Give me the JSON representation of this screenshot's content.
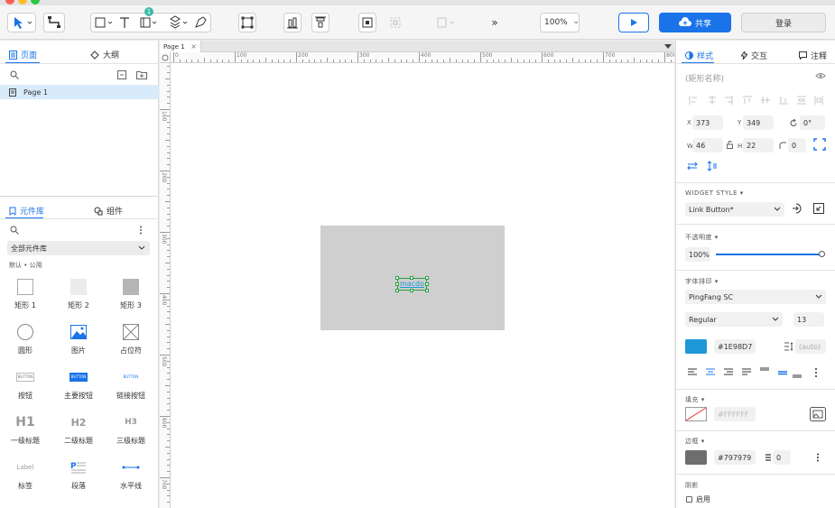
{
  "toolbar": {
    "zoom": "100%",
    "share_label": "共享",
    "login_label": "登录",
    "notification_count": "1",
    "more_symbol": "»"
  },
  "left_panel": {
    "pages_tab": "页面",
    "outline_tab": "大纲",
    "page_item": "Page 1",
    "library_tab": "元件库",
    "components_tab": "组件",
    "library_select": "全部元件库",
    "library_subtitle": "默认 • 公用",
    "widgets": [
      {
        "label": "矩形 1"
      },
      {
        "label": "矩形 2"
      },
      {
        "label": "矩形 3"
      },
      {
        "label": "圆形"
      },
      {
        "label": "图片"
      },
      {
        "label": "占位符"
      },
      {
        "label": "按钮"
      },
      {
        "label": "主要按钮"
      },
      {
        "label": "链接按钮"
      },
      {
        "label": "一级标题"
      },
      {
        "label": "二级标题"
      },
      {
        "label": "三级标题"
      },
      {
        "label": "标签"
      },
      {
        "label": "段落"
      },
      {
        "label": "水平线"
      }
    ],
    "widget_glyphs": {
      "button": "BUTTON",
      "h1": "H1",
      "h2": "H2",
      "h3": "H3",
      "label": "Label"
    }
  },
  "canvas": {
    "page_tab": "Page 1",
    "ruler_h": [
      "0",
      "100",
      "200",
      "300",
      "400",
      "500",
      "600",
      "700",
      "800"
    ],
    "ruler_v": [
      "100",
      "200",
      "300",
      "400",
      "500",
      "600",
      "700"
    ],
    "selected_text": "macdo"
  },
  "right_panel": {
    "tabs": {
      "style": "样式",
      "interact": "交互",
      "notes": "注释"
    },
    "shape_name_placeholder": "(矩形名称)",
    "x_label": "X",
    "x": "373",
    "y_label": "Y",
    "y": "349",
    "rotation": "0°",
    "w_label": "W",
    "w": "46",
    "h_label": "H",
    "h": "22",
    "radius": "0",
    "widget_style_label": "WIDGET STYLE",
    "widget_style": "Link Button*",
    "opacity_label": "不透明度",
    "opacity": "100%",
    "opacity_level": 1.0,
    "typography_label": "字体排印",
    "font_family": "PingFang SC",
    "font_weight": "Regular",
    "font_size": "13",
    "text_color": "#1E98D7",
    "line_height": "(auto)",
    "fill_label": "填充",
    "fill_color": "#FFFFFF",
    "border_label": "边框",
    "border_color": "#797979",
    "border_width": "0",
    "shadow_label": "阴影",
    "shadow_enable": "启用"
  },
  "colors": {
    "accent": "#1a73e8",
    "selection": "#27a143",
    "text_color_swatch": "#1E98D7",
    "border_swatch": "#6e6e6e",
    "page_bg": "#cfcfcf"
  }
}
